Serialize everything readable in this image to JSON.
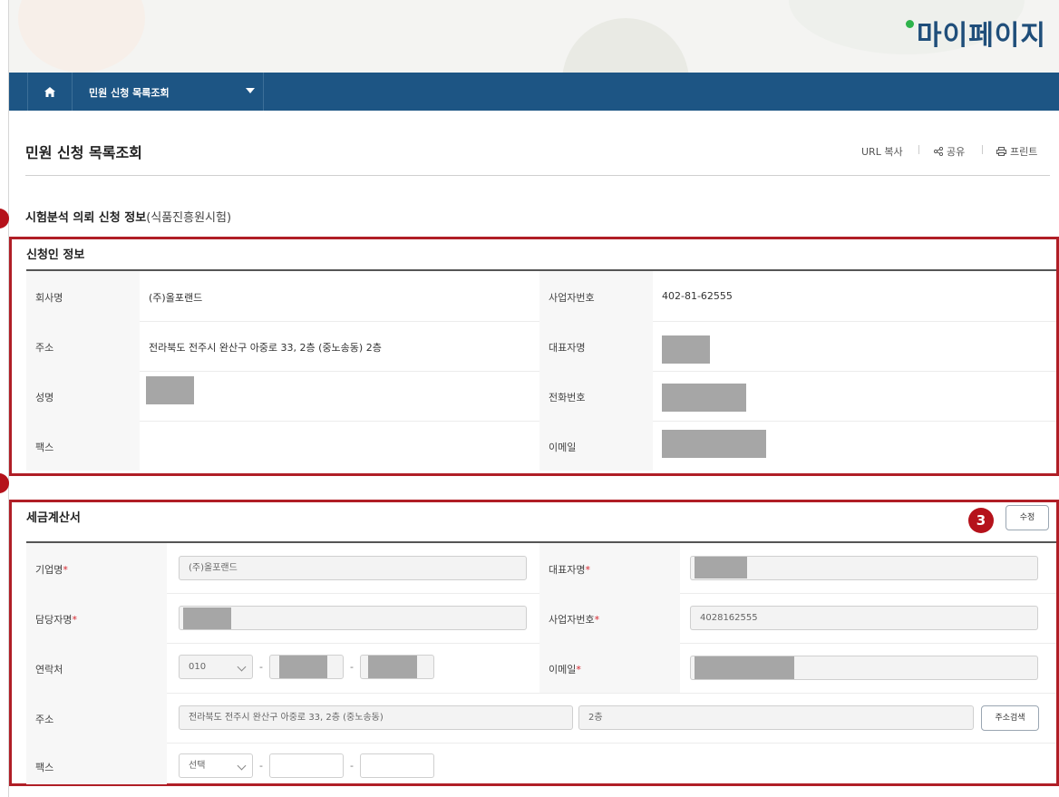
{
  "header": {
    "page_heading": "마이페이지"
  },
  "nav": {
    "home_icon": "home-icon",
    "menu_label": "민원 신청 목록조회"
  },
  "title": "민원 신청 목록조회",
  "utilities": {
    "url_copy": "URL 복사",
    "share": "공유",
    "print": "프린트"
  },
  "section": {
    "title": "시험분석 의뢰 신청 정보",
    "subtitle": "(식품진흥원시험)"
  },
  "applicant": {
    "title": "신청인 정보",
    "company_label": "회사명",
    "company_value": "(주)올포랜드",
    "bizno_label": "사업자번호",
    "bizno_value": "402-81-62555",
    "address_label": "주소",
    "address_value": "전라북도 전주시 완산구 아중로 33, 2층 (중노송동)  2층",
    "ceo_label": "대표자명",
    "name_label": "성명",
    "phone_label": "전화번호",
    "fax_label": "팩스",
    "email_label": "이메일"
  },
  "tax": {
    "title": "세금계산서",
    "edit_button": "수정",
    "company_label": "기업명",
    "company_value": "(주)올포랜드",
    "ceo_label": "대표자명",
    "manager_label": "담당자명",
    "bizno_label": "사업자번호",
    "bizno_value": "4028162555",
    "contact_label": "연락처",
    "contact_prefix": "010",
    "email_label": "이메일",
    "address_label": "주소",
    "address_value": "전라북도 전주시 완산구 아중로 33, 2층 (중노송동)",
    "address_detail": "2층",
    "address_search_button": "주소검색",
    "fax_label": "팩스",
    "fax_prefix": "선택",
    "required_mark": "*",
    "dash": "-"
  },
  "markers": {
    "m3": "3"
  }
}
